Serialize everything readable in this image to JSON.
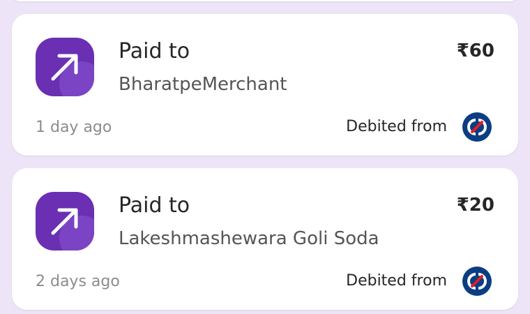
{
  "transactions": [
    {
      "direction_icon": "arrow-up-right-icon",
      "title": "Paid to",
      "merchant": "BharatpeMerchant",
      "amount": "₹60",
      "time_ago": "1 day ago",
      "debited_label": "Debited from",
      "bank_icon": "kotak-bank-logo"
    },
    {
      "direction_icon": "arrow-up-right-icon",
      "title": "Paid to",
      "merchant": "Lakeshmashewara Goli Soda",
      "amount": "₹20",
      "time_ago": "2 days ago",
      "debited_label": "Debited from",
      "bank_icon": "kotak-bank-logo"
    }
  ],
  "colors": {
    "background": "#ede5f7",
    "card": "#ffffff",
    "icon_bg": "#6a2fb3",
    "bank_logo": "#0b3d82",
    "bank_logo_accent": "#e31e24"
  }
}
